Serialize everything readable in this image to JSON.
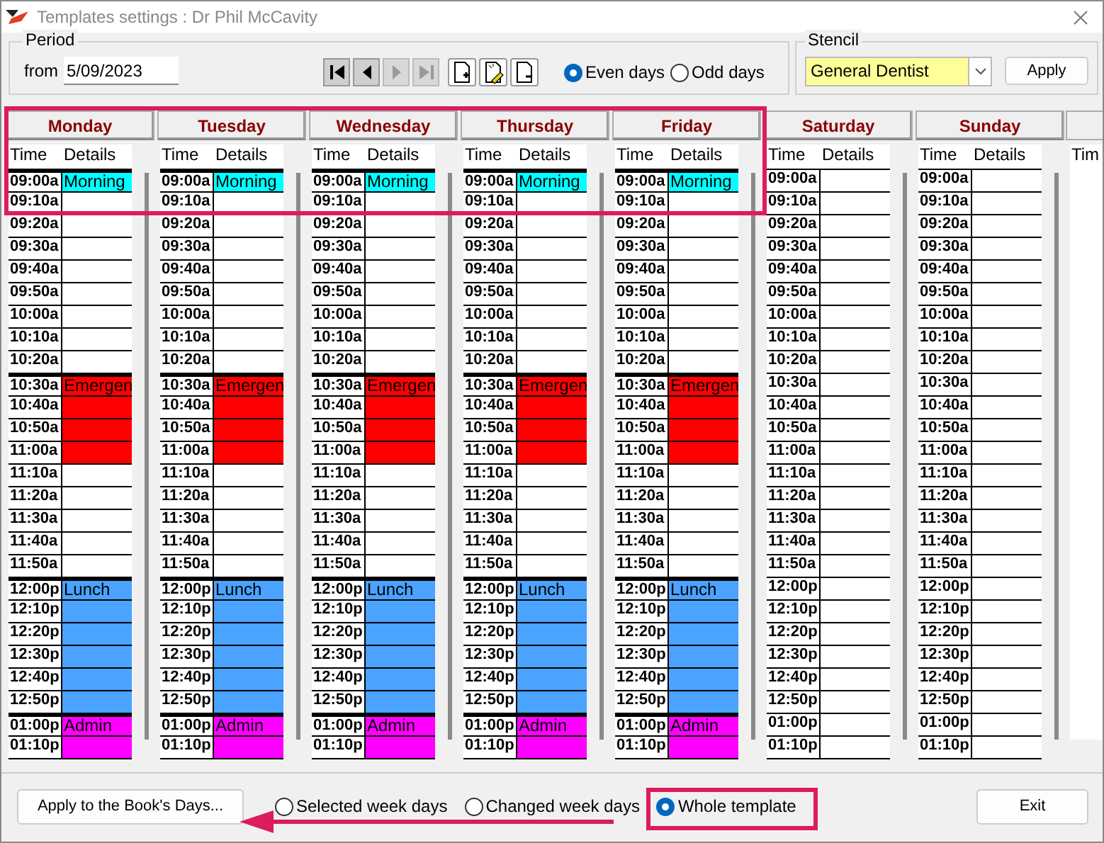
{
  "window": {
    "title": "Templates settings : Dr Phil McCavity"
  },
  "period": {
    "legend": "Period",
    "from_label": "from",
    "from_value": "5/09/2023"
  },
  "nav_buttons": [
    {
      "kind": "first",
      "disabled": false
    },
    {
      "kind": "prev",
      "disabled": false
    },
    {
      "kind": "next",
      "disabled": true
    },
    {
      "kind": "last",
      "disabled": true
    }
  ],
  "doc_buttons": [
    {
      "kind": "add"
    },
    {
      "kind": "edit"
    },
    {
      "kind": "remove"
    }
  ],
  "day_parity": [
    {
      "label": "Even days",
      "selected": true
    },
    {
      "label": "Odd days",
      "selected": false
    }
  ],
  "stencil": {
    "legend": "Stencil",
    "value": "General Dentist",
    "apply": "Apply"
  },
  "days": [
    {
      "name": "Monday",
      "time_header": "Time",
      "details_header": "Details",
      "slots": [
        {
          "time": "09:00a",
          "details": "Morning",
          "color": "#00ffff"
        },
        {
          "time": "09:10a"
        },
        {
          "time": "09:20a"
        },
        {
          "time": "09:30a"
        },
        {
          "time": "09:40a"
        },
        {
          "time": "09:50a"
        },
        {
          "time": "10:00a"
        },
        {
          "time": "10:10a"
        },
        {
          "time": "10:20a"
        },
        {
          "time": "10:30a",
          "details": "Emergen",
          "color": "#ff0000"
        },
        {
          "time": "10:40a",
          "color": "#ff0000"
        },
        {
          "time": "10:50a",
          "color": "#ff0000"
        },
        {
          "time": "11:00a",
          "color": "#ff0000"
        },
        {
          "time": "11:10a"
        },
        {
          "time": "11:20a"
        },
        {
          "time": "11:30a"
        },
        {
          "time": "11:40a"
        },
        {
          "time": "11:50a"
        },
        {
          "time": "12:00p",
          "details": "Lunch",
          "color": "#49a3ff"
        },
        {
          "time": "12:10p",
          "color": "#49a3ff"
        },
        {
          "time": "12:20p",
          "color": "#49a3ff"
        },
        {
          "time": "12:30p",
          "color": "#49a3ff"
        },
        {
          "time": "12:40p",
          "color": "#49a3ff"
        },
        {
          "time": "12:50p",
          "color": "#49a3ff"
        },
        {
          "time": "01:00p",
          "details": "Admin",
          "color": "#ff00ff"
        },
        {
          "time": "01:10p",
          "color": "#ff00ff"
        }
      ]
    },
    {
      "name": "Tuesday",
      "time_header": "Time",
      "details_header": "Details",
      "slots": [
        {
          "time": "09:00a",
          "details": "Morning",
          "color": "#00ffff"
        },
        {
          "time": "09:10a"
        },
        {
          "time": "09:20a"
        },
        {
          "time": "09:30a"
        },
        {
          "time": "09:40a"
        },
        {
          "time": "09:50a"
        },
        {
          "time": "10:00a"
        },
        {
          "time": "10:10a"
        },
        {
          "time": "10:20a"
        },
        {
          "time": "10:30a",
          "details": "Emergen",
          "color": "#ff0000"
        },
        {
          "time": "10:40a",
          "color": "#ff0000"
        },
        {
          "time": "10:50a",
          "color": "#ff0000"
        },
        {
          "time": "11:00a",
          "color": "#ff0000"
        },
        {
          "time": "11:10a"
        },
        {
          "time": "11:20a"
        },
        {
          "time": "11:30a"
        },
        {
          "time": "11:40a"
        },
        {
          "time": "11:50a"
        },
        {
          "time": "12:00p",
          "details": "Lunch",
          "color": "#49a3ff"
        },
        {
          "time": "12:10p",
          "color": "#49a3ff"
        },
        {
          "time": "12:20p",
          "color": "#49a3ff"
        },
        {
          "time": "12:30p",
          "color": "#49a3ff"
        },
        {
          "time": "12:40p",
          "color": "#49a3ff"
        },
        {
          "time": "12:50p",
          "color": "#49a3ff"
        },
        {
          "time": "01:00p",
          "details": "Admin",
          "color": "#ff00ff"
        },
        {
          "time": "01:10p",
          "color": "#ff00ff"
        }
      ]
    },
    {
      "name": "Wednesday",
      "time_header": "Time",
      "details_header": "Details",
      "slots": [
        {
          "time": "09:00a",
          "details": "Morning",
          "color": "#00ffff"
        },
        {
          "time": "09:10a"
        },
        {
          "time": "09:20a"
        },
        {
          "time": "09:30a"
        },
        {
          "time": "09:40a"
        },
        {
          "time": "09:50a"
        },
        {
          "time": "10:00a"
        },
        {
          "time": "10:10a"
        },
        {
          "time": "10:20a"
        },
        {
          "time": "10:30a",
          "details": "Emergen",
          "color": "#ff0000"
        },
        {
          "time": "10:40a",
          "color": "#ff0000"
        },
        {
          "time": "10:50a",
          "color": "#ff0000"
        },
        {
          "time": "11:00a",
          "color": "#ff0000"
        },
        {
          "time": "11:10a"
        },
        {
          "time": "11:20a"
        },
        {
          "time": "11:30a"
        },
        {
          "time": "11:40a"
        },
        {
          "time": "11:50a"
        },
        {
          "time": "12:00p",
          "details": "Lunch",
          "color": "#49a3ff"
        },
        {
          "time": "12:10p",
          "color": "#49a3ff"
        },
        {
          "time": "12:20p",
          "color": "#49a3ff"
        },
        {
          "time": "12:30p",
          "color": "#49a3ff"
        },
        {
          "time": "12:40p",
          "color": "#49a3ff"
        },
        {
          "time": "12:50p",
          "color": "#49a3ff"
        },
        {
          "time": "01:00p",
          "details": "Admin",
          "color": "#ff00ff"
        },
        {
          "time": "01:10p",
          "color": "#ff00ff"
        }
      ]
    },
    {
      "name": "Thursday",
      "time_header": "Time",
      "details_header": "Details",
      "slots": [
        {
          "time": "09:00a",
          "details": "Morning",
          "color": "#00ffff"
        },
        {
          "time": "09:10a"
        },
        {
          "time": "09:20a"
        },
        {
          "time": "09:30a"
        },
        {
          "time": "09:40a"
        },
        {
          "time": "09:50a"
        },
        {
          "time": "10:00a"
        },
        {
          "time": "10:10a"
        },
        {
          "time": "10:20a"
        },
        {
          "time": "10:30a",
          "details": "Emergen",
          "color": "#ff0000"
        },
        {
          "time": "10:40a",
          "color": "#ff0000"
        },
        {
          "time": "10:50a",
          "color": "#ff0000"
        },
        {
          "time": "11:00a",
          "color": "#ff0000"
        },
        {
          "time": "11:10a"
        },
        {
          "time": "11:20a"
        },
        {
          "time": "11:30a"
        },
        {
          "time": "11:40a"
        },
        {
          "time": "11:50a"
        },
        {
          "time": "12:00p",
          "details": "Lunch",
          "color": "#49a3ff"
        },
        {
          "time": "12:10p",
          "color": "#49a3ff"
        },
        {
          "time": "12:20p",
          "color": "#49a3ff"
        },
        {
          "time": "12:30p",
          "color": "#49a3ff"
        },
        {
          "time": "12:40p",
          "color": "#49a3ff"
        },
        {
          "time": "12:50p",
          "color": "#49a3ff"
        },
        {
          "time": "01:00p",
          "details": "Admin",
          "color": "#ff00ff"
        },
        {
          "time": "01:10p",
          "color": "#ff00ff"
        }
      ]
    },
    {
      "name": "Friday",
      "time_header": "Time",
      "details_header": "Details",
      "slots": [
        {
          "time": "09:00a",
          "details": "Morning",
          "color": "#00ffff"
        },
        {
          "time": "09:10a"
        },
        {
          "time": "09:20a"
        },
        {
          "time": "09:30a"
        },
        {
          "time": "09:40a"
        },
        {
          "time": "09:50a"
        },
        {
          "time": "10:00a"
        },
        {
          "time": "10:10a"
        },
        {
          "time": "10:20a"
        },
        {
          "time": "10:30a",
          "details": "Emergen",
          "color": "#ff0000"
        },
        {
          "time": "10:40a",
          "color": "#ff0000"
        },
        {
          "time": "10:50a",
          "color": "#ff0000"
        },
        {
          "time": "11:00a",
          "color": "#ff0000"
        },
        {
          "time": "11:10a"
        },
        {
          "time": "11:20a"
        },
        {
          "time": "11:30a"
        },
        {
          "time": "11:40a"
        },
        {
          "time": "11:50a"
        },
        {
          "time": "12:00p",
          "details": "Lunch",
          "color": "#49a3ff"
        },
        {
          "time": "12:10p",
          "color": "#49a3ff"
        },
        {
          "time": "12:20p",
          "color": "#49a3ff"
        },
        {
          "time": "12:30p",
          "color": "#49a3ff"
        },
        {
          "time": "12:40p",
          "color": "#49a3ff"
        },
        {
          "time": "12:50p",
          "color": "#49a3ff"
        },
        {
          "time": "01:00p",
          "details": "Admin",
          "color": "#ff00ff"
        },
        {
          "time": "01:10p",
          "color": "#ff00ff"
        }
      ]
    },
    {
      "name": "Saturday",
      "time_header": "Time",
      "details_header": "Details",
      "slots": [
        {
          "time": "09:00a"
        },
        {
          "time": "09:10a"
        },
        {
          "time": "09:20a"
        },
        {
          "time": "09:30a"
        },
        {
          "time": "09:40a"
        },
        {
          "time": "09:50a"
        },
        {
          "time": "10:00a"
        },
        {
          "time": "10:10a"
        },
        {
          "time": "10:20a"
        },
        {
          "time": "10:30a"
        },
        {
          "time": "10:40a"
        },
        {
          "time": "10:50a"
        },
        {
          "time": "11:00a"
        },
        {
          "time": "11:10a"
        },
        {
          "time": "11:20a"
        },
        {
          "time": "11:30a"
        },
        {
          "time": "11:40a"
        },
        {
          "time": "11:50a"
        },
        {
          "time": "12:00p"
        },
        {
          "time": "12:10p"
        },
        {
          "time": "12:20p"
        },
        {
          "time": "12:30p"
        },
        {
          "time": "12:40p"
        },
        {
          "time": "12:50p"
        },
        {
          "time": "01:00p"
        },
        {
          "time": "01:10p"
        }
      ]
    },
    {
      "name": "Sunday",
      "time_header": "Time",
      "details_header": "Details",
      "slots": [
        {
          "time": "09:00a"
        },
        {
          "time": "09:10a"
        },
        {
          "time": "09:20a"
        },
        {
          "time": "09:30a"
        },
        {
          "time": "09:40a"
        },
        {
          "time": "09:50a"
        },
        {
          "time": "10:00a"
        },
        {
          "time": "10:10a"
        },
        {
          "time": "10:20a"
        },
        {
          "time": "10:30a"
        },
        {
          "time": "10:40a"
        },
        {
          "time": "10:50a"
        },
        {
          "time": "11:00a"
        },
        {
          "time": "11:10a"
        },
        {
          "time": "11:20a"
        },
        {
          "time": "11:30a"
        },
        {
          "time": "11:40a"
        },
        {
          "time": "11:50a"
        },
        {
          "time": "12:00p"
        },
        {
          "time": "12:10p"
        },
        {
          "time": "12:20p"
        },
        {
          "time": "12:30p"
        },
        {
          "time": "12:40p"
        },
        {
          "time": "12:50p"
        },
        {
          "time": "01:00p"
        },
        {
          "time": "01:10p"
        }
      ]
    }
  ],
  "partial_column": {
    "time_header": "Tim"
  },
  "bottom": {
    "apply_button": "Apply to the Book's Days...",
    "scope": [
      {
        "label": "Selected week days",
        "selected": false
      },
      {
        "label": "Changed week days",
        "selected": false
      },
      {
        "label": "Whole template",
        "selected": true
      }
    ],
    "exit": "Exit"
  }
}
